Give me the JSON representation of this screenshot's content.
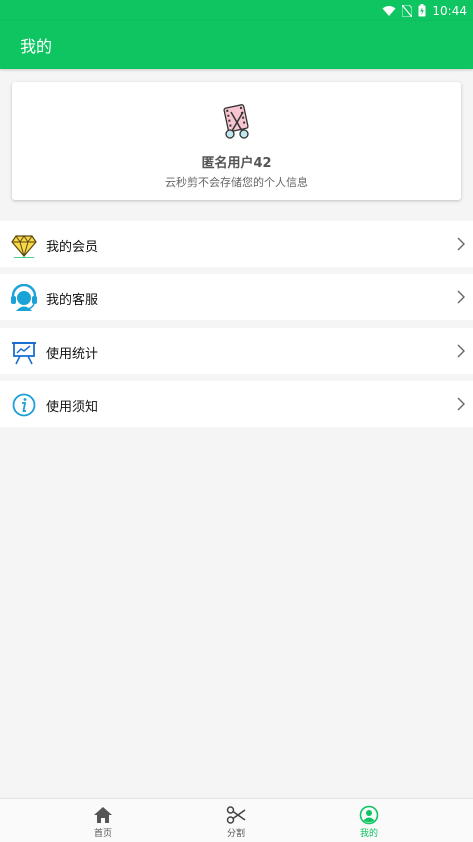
{
  "status_bar": {
    "time": "10:44"
  },
  "app_bar": {
    "title": "我的"
  },
  "profile": {
    "username": "匿名用户42",
    "subtitle": "云秒剪不会存储您的个人信息",
    "avatar_icon": "scissors-film-icon"
  },
  "menu": [
    {
      "label": "我的会员",
      "icon": "diamond-icon"
    },
    {
      "label": "我的客服",
      "icon": "headset-icon"
    },
    {
      "label": "使用统计",
      "icon": "chart-board-icon"
    },
    {
      "label": "使用须知",
      "icon": "info-icon"
    }
  ],
  "bottom_nav": [
    {
      "label": "首页",
      "icon": "home-icon",
      "active": false
    },
    {
      "label": "分割",
      "icon": "scissors-icon",
      "active": false
    },
    {
      "label": "我的",
      "icon": "person-icon",
      "active": true
    }
  ],
  "colors": {
    "primary": "#0ec562",
    "background": "#f5f5f5"
  }
}
